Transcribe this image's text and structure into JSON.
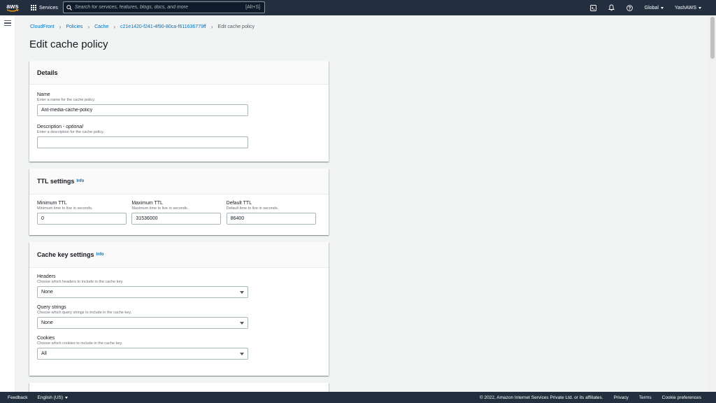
{
  "topnav": {
    "logo_text": "aws",
    "services_label": "Services",
    "search_placeholder": "Search for services, features, blogs, docs, and more",
    "search_shortcut": "[Alt+S]",
    "region_label": "Global",
    "account_label": "YashAWS"
  },
  "breadcrumb": {
    "items": [
      "CloudFront",
      "Policies",
      "Cache",
      "c21e1420-f241-4f90-80ca-f611636779ff"
    ],
    "current": "Edit cache policy"
  },
  "page_title": "Edit cache policy",
  "details": {
    "heading": "Details",
    "name_label": "Name",
    "name_desc": "Enter a name for the cache policy.",
    "name_value": "Ant-media-cache-policy",
    "description_label": "Description - ",
    "description_optional": "optional",
    "description_desc": "Enter a description for the cache policy.",
    "description_value": ""
  },
  "ttl": {
    "heading": "TTL settings",
    "info": "Info",
    "min_label": "Minimum TTL",
    "min_desc": "Minimum time to live in seconds.",
    "min_value": "0",
    "max_label": "Maximum TTL",
    "max_desc": "Maximum time to live in seconds.",
    "max_value": "31536000",
    "default_label": "Default TTL",
    "default_desc": "Default time to live in seconds.",
    "default_value": "86400"
  },
  "cache_key": {
    "heading": "Cache key settings",
    "info": "Info",
    "headers_label": "Headers",
    "headers_desc": "Choose which headers to include in the cache key.",
    "headers_value": "None",
    "query_label": "Query strings",
    "query_desc": "Choose which query strings to include in the cache key.",
    "query_value": "None",
    "cookies_label": "Cookies",
    "cookies_desc": "Choose which cookies to include in the cache key.",
    "cookies_value": "All"
  },
  "footer": {
    "feedback": "Feedback",
    "language": "English (US)",
    "copyright": "© 2022, Amazon Internet Services Private Ltd. or its affiliates.",
    "privacy": "Privacy",
    "terms": "Terms",
    "cookie_prefs": "Cookie preferences"
  },
  "colors": {
    "nav_bg": "#232f3e",
    "link": "#0073bb",
    "page_bg": "#f2f3f3"
  }
}
